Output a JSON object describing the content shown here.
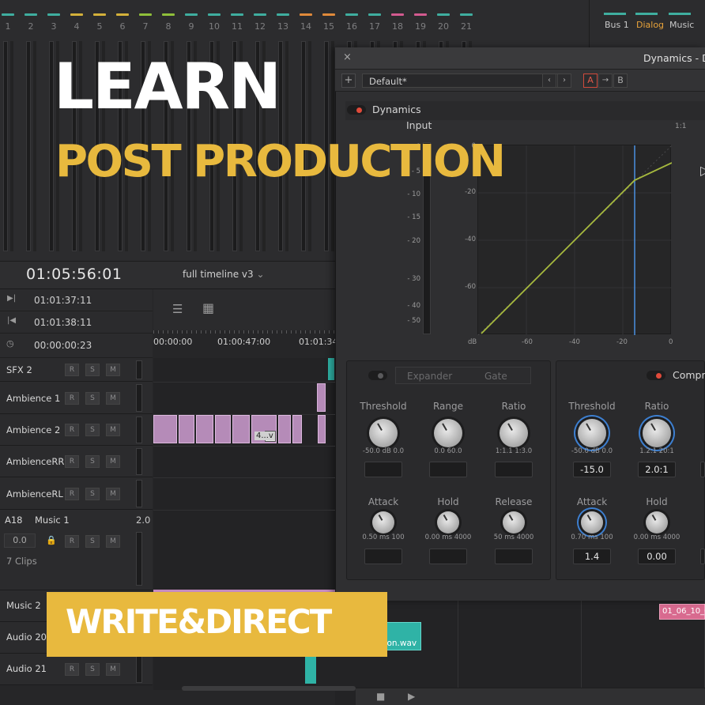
{
  "colors": {
    "accent_yellow": "#e8b93e",
    "clip_pink": "#b58bb8",
    "meter_blue": "#4a90e2",
    "curve_green": "#a6b93e",
    "red_toggle": "#e04a3a"
  },
  "channel_numbers": [
    "1",
    "2",
    "3",
    "4",
    "5",
    "6",
    "7",
    "8",
    "9",
    "10",
    "11",
    "12",
    "13",
    "14",
    "15",
    "16",
    "17",
    "18",
    "19",
    "20",
    "21"
  ],
  "channel_colors": [
    "#3fae9f",
    "#3fae9f",
    "#3fae9f",
    "#d4b13a",
    "#d4b13a",
    "#d4b13a",
    "#8fbf3a",
    "#8fbf3a",
    "#3fae9f",
    "#3fae9f",
    "#3fae9f",
    "#3fae9f",
    "#3fae9f",
    "#e08a3a",
    "#e08a3a",
    "#3fae9f",
    "#3fae9f",
    "#d35a8f",
    "#d35a8f",
    "#3fae9f",
    "#3fae9f"
  ],
  "buses": [
    "Bus 1",
    "Dialog",
    "Music"
  ],
  "timeline": {
    "timecode": "01:05:56:01",
    "name": "full timeline v3",
    "in_time": "01:01:37:11",
    "out_time": "01:01:38:11",
    "duration": "00:00:00:23",
    "ruler": [
      "00:00:00",
      "01:00:47:00",
      "01:01:34"
    ]
  },
  "tracks": [
    {
      "name": "SFX 2"
    },
    {
      "name": "Ambience 1"
    },
    {
      "name": "Ambience 2"
    },
    {
      "name": "AmbienceRR"
    },
    {
      "name": "AmbienceRL"
    }
  ],
  "music_track": {
    "id": "A18",
    "name": "Music 1",
    "gain": "2.0",
    "level": "0.0",
    "clips": "7 Clips"
  },
  "lower_tracks": [
    {
      "name": "Music 2"
    },
    {
      "name": "Audio 20"
    },
    {
      "name": "Audio 21"
    }
  ],
  "track_buttons": [
    "R",
    "S",
    "M"
  ],
  "clip_labels": {
    "ambience2_clip": "4...v",
    "audio20_clip": "son.wav",
    "music2_clip": "01_06_10_0"
  },
  "dynamics": {
    "title": "Dynamics - D",
    "close": "×",
    "preset": "Default*",
    "ab": [
      "A",
      "→",
      "B"
    ],
    "section": "Dynamics",
    "input_label": "Input",
    "ratio_corner": "1:1",
    "db_scale": [
      "0",
      "- 5",
      "- 10",
      "- 15",
      "- 20",
      "- 30",
      "- 40",
      "- 50"
    ],
    "graph_y": [
      "0",
      "-20",
      "-40",
      "-60"
    ],
    "graph_x": [
      "dB",
      "-60",
      "-40",
      "-20",
      "0"
    ],
    "expander_tab": "Expander",
    "gate_tab": "Gate",
    "compressor_label": "Compr",
    "expander": {
      "row1": [
        {
          "label": "Threshold",
          "range": "-50.0 dB  0.0"
        },
        {
          "label": "Range",
          "range": "0.0     60.0"
        },
        {
          "label": "Ratio",
          "range": "1:1.1    1:3.0"
        }
      ],
      "row2": [
        {
          "label": "Attack",
          "range": "0.50  ms  100"
        },
        {
          "label": "Hold",
          "range": "0.00  ms  4000"
        },
        {
          "label": "Release",
          "range": "50  ms  4000"
        }
      ]
    },
    "compressor": {
      "row1": [
        {
          "label": "Threshold",
          "range": "-50.0 dB  0.0",
          "value": "-15.0"
        },
        {
          "label": "Ratio",
          "range": "1.2:1     20:1",
          "value": "2.0:1"
        }
      ],
      "row2": [
        {
          "label": "Attack",
          "range": "0.70  ms  100",
          "value": "1.4"
        },
        {
          "label": "Hold",
          "range": "0.00  ms  4000",
          "value": "0.00"
        }
      ]
    }
  },
  "overlay": {
    "line1": "LEARN",
    "line2": "POST PRODUCTION",
    "badge": "WRITE&DIRECT"
  }
}
